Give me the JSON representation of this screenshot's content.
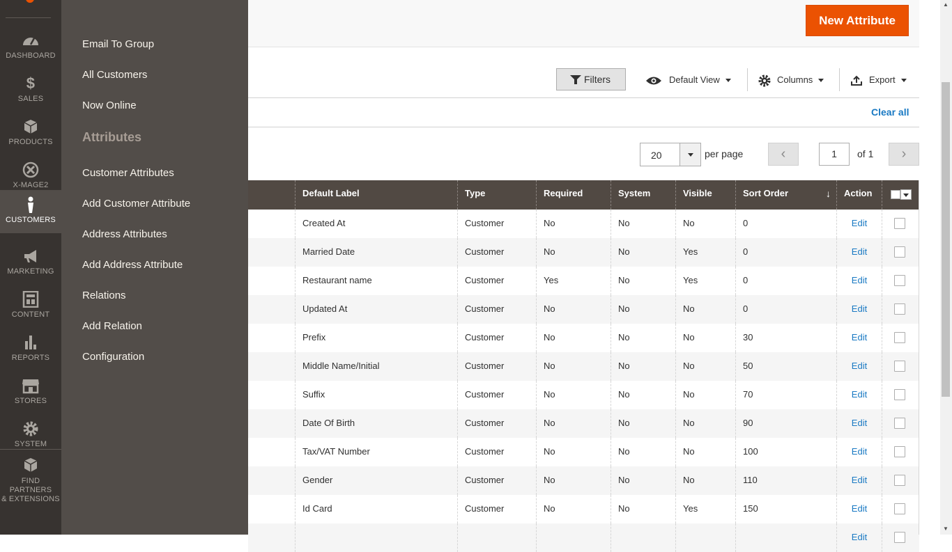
{
  "nav": {
    "items": [
      {
        "label": "DASHBOARD",
        "icon": "dashboard-icon"
      },
      {
        "label": "SALES",
        "icon": "dollar-icon"
      },
      {
        "label": "PRODUCTS",
        "icon": "box-icon"
      },
      {
        "label": "X-MAGE2",
        "icon": "x-mage2-icon"
      },
      {
        "label": "CUSTOMERS",
        "icon": "person-icon"
      },
      {
        "label": "MARKETING",
        "icon": "megaphone-icon"
      },
      {
        "label": "CONTENT",
        "icon": "layout-icon"
      },
      {
        "label": "REPORTS",
        "icon": "bar-chart-icon"
      },
      {
        "label": "STORES",
        "icon": "storefront-icon"
      },
      {
        "label": "SYSTEM",
        "icon": "gear-icon"
      }
    ],
    "find_partners_line1": "FIND PARTNERS",
    "find_partners_line2": "& EXTENSIONS",
    "active_color": "#524d49",
    "brand_color": "#eb5202"
  },
  "flyout": {
    "links_top": [
      "Email To Group",
      "All Customers",
      "Now Online"
    ],
    "section_title": "Attributes",
    "links_bottom": [
      "Customer Attributes",
      "Add Customer Attribute",
      "Address Attributes",
      "Add Address Attribute",
      "Relations",
      "Add Relation",
      "Configuration"
    ]
  },
  "header": {
    "new_attribute_label": "New Attribute"
  },
  "toolbar": {
    "filters_label": "Filters",
    "view_label": "Default View",
    "columns_label": "Columns",
    "export_label": "Export",
    "clear_all_label": "Clear all"
  },
  "pager": {
    "per_page_value": "20",
    "per_page_label": "per page",
    "current_page": "1",
    "of_label": "of 1"
  },
  "table": {
    "columns": [
      "Default Label",
      "Type",
      "Required",
      "System",
      "Visible",
      "Sort Order",
      "Action"
    ],
    "sort_indicator": "↓",
    "rows": [
      {
        "label": "Created At",
        "type": "Customer",
        "required": "No",
        "system": "No",
        "visible": "No",
        "sort": "0",
        "action": "Edit"
      },
      {
        "label": "Married Date",
        "type": "Customer",
        "required": "No",
        "system": "No",
        "visible": "Yes",
        "sort": "0",
        "action": "Edit"
      },
      {
        "label": "Restaurant name",
        "type": "Customer",
        "required": "Yes",
        "system": "No",
        "visible": "Yes",
        "sort": "0",
        "action": "Edit"
      },
      {
        "label": "Updated At",
        "type": "Customer",
        "required": "No",
        "system": "No",
        "visible": "No",
        "sort": "0",
        "action": "Edit"
      },
      {
        "label": "Prefix",
        "type": "Customer",
        "required": "No",
        "system": "No",
        "visible": "No",
        "sort": "30",
        "action": "Edit"
      },
      {
        "label": "Middle Name/Initial",
        "type": "Customer",
        "required": "No",
        "system": "No",
        "visible": "No",
        "sort": "50",
        "action": "Edit"
      },
      {
        "label": "Suffix",
        "type": "Customer",
        "required": "No",
        "system": "No",
        "visible": "No",
        "sort": "70",
        "action": "Edit"
      },
      {
        "label": "Date Of Birth",
        "type": "Customer",
        "required": "No",
        "system": "No",
        "visible": "No",
        "sort": "90",
        "action": "Edit"
      },
      {
        "label": "Tax/VAT Number",
        "type": "Customer",
        "required": "No",
        "system": "No",
        "visible": "No",
        "sort": "100",
        "action": "Edit"
      },
      {
        "label": "Gender",
        "type": "Customer",
        "required": "No",
        "system": "No",
        "visible": "No",
        "sort": "110",
        "action": "Edit"
      },
      {
        "label": "Id Card",
        "type": "Customer",
        "required": "No",
        "system": "No",
        "visible": "Yes",
        "sort": "150",
        "action": "Edit"
      },
      {
        "label": "",
        "type": "",
        "required": "",
        "system": "",
        "visible": "",
        "sort": "",
        "action": "Edit"
      }
    ]
  }
}
